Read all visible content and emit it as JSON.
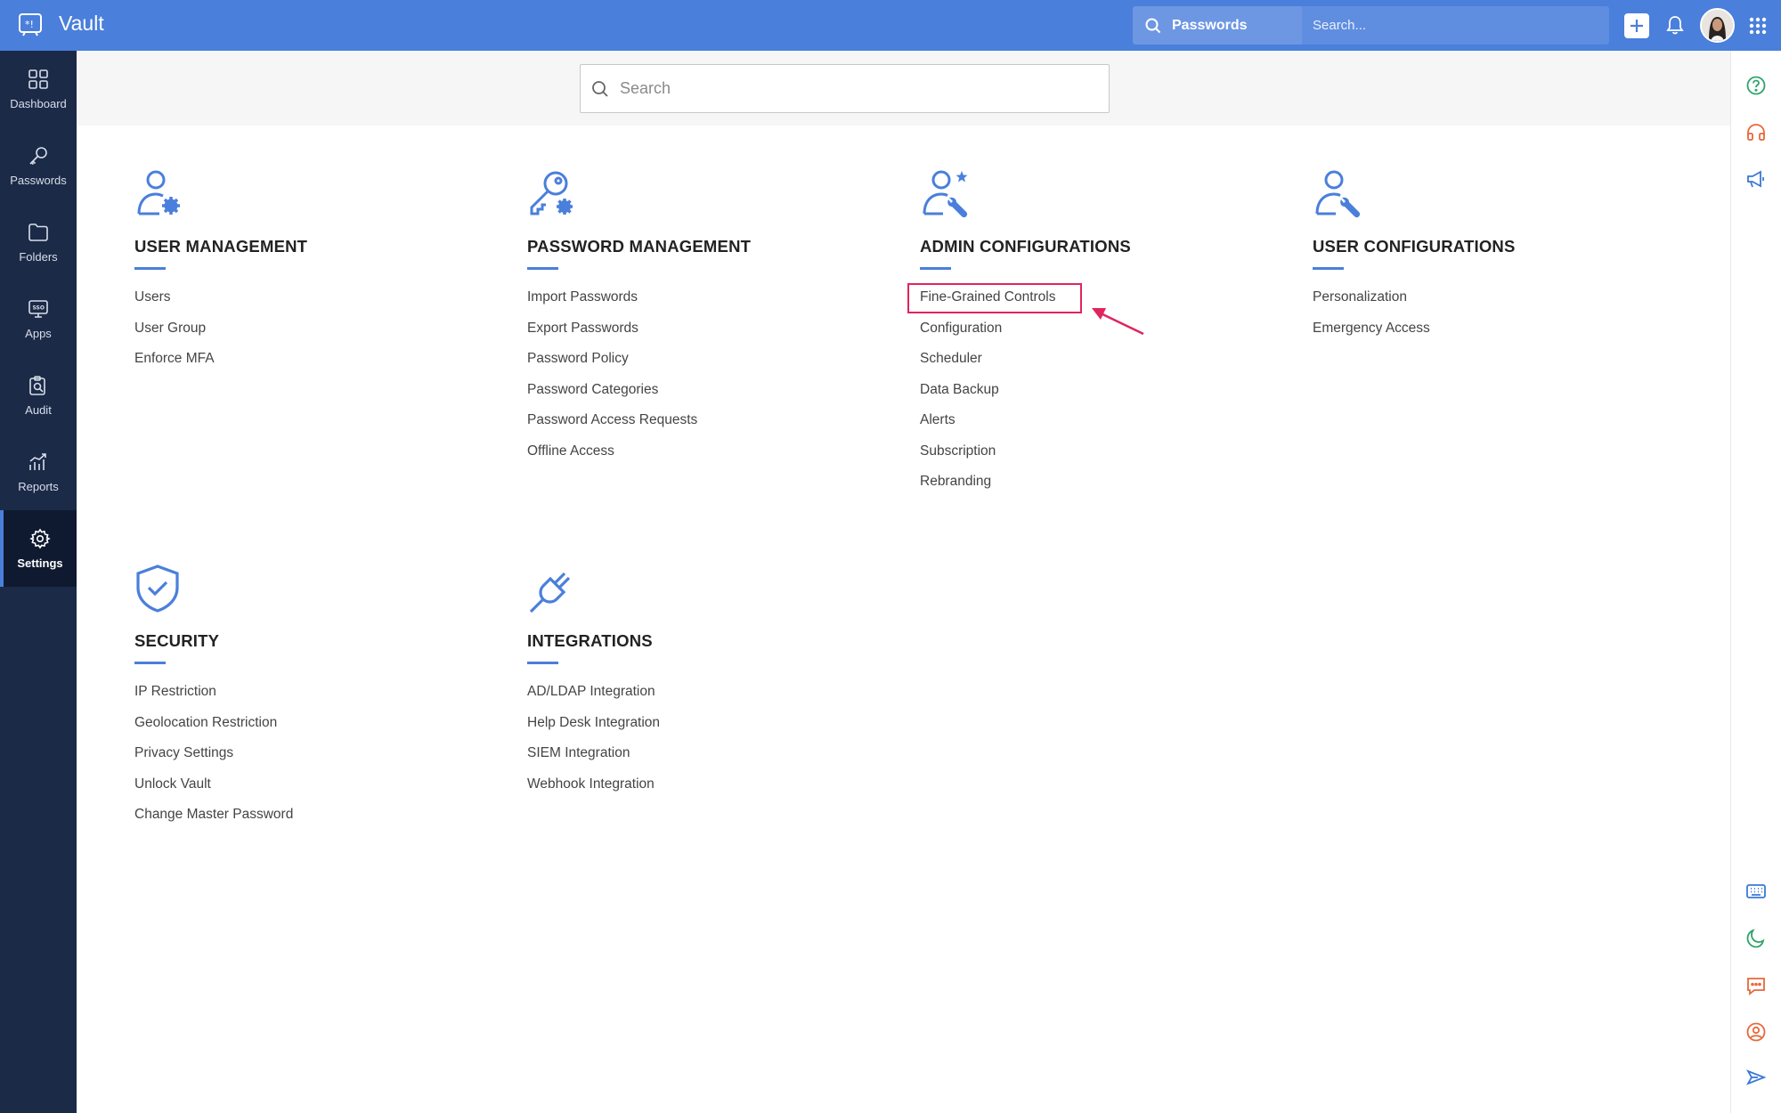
{
  "app": {
    "title": "Vault"
  },
  "topbar": {
    "search_scope": "Passwords",
    "search_placeholder": "Search...",
    "icons": [
      "vault-logo-icon",
      "search-icon",
      "plus-icon",
      "bell-icon",
      "avatar",
      "app-grid-icon"
    ]
  },
  "sidebar": {
    "items": [
      {
        "label": "Dashboard",
        "icon": "dashboard-icon"
      },
      {
        "label": "Passwords",
        "icon": "key-icon"
      },
      {
        "label": "Folders",
        "icon": "folder-icon"
      },
      {
        "label": "Apps",
        "icon": "sso-icon"
      },
      {
        "label": "Audit",
        "icon": "audit-icon"
      },
      {
        "label": "Reports",
        "icon": "reports-icon"
      },
      {
        "label": "Settings",
        "icon": "gear-icon",
        "active": true
      }
    ]
  },
  "main_search": {
    "placeholder": "Search"
  },
  "sections": {
    "user_management": {
      "title": "USER MANAGEMENT",
      "items": [
        "Users",
        "User Group",
        "Enforce MFA"
      ]
    },
    "password_management": {
      "title": "PASSWORD MANAGEMENT",
      "items": [
        "Import Passwords",
        "Export Passwords",
        "Password Policy",
        "Password Categories",
        "Password Access Requests",
        "Offline Access"
      ]
    },
    "admin_configurations": {
      "title": "ADMIN CONFIGURATIONS",
      "items": [
        "Fine-Grained Controls",
        "Configuration",
        "Scheduler",
        "Data Backup",
        "Alerts",
        "Subscription",
        "Rebranding"
      ]
    },
    "user_configurations": {
      "title": "USER CONFIGURATIONS",
      "items": [
        "Personalization",
        "Emergency Access"
      ]
    },
    "security": {
      "title": "SECURITY",
      "items": [
        "IP Restriction",
        "Geolocation Restriction",
        "Privacy Settings",
        "Unlock Vault",
        "Change Master Password"
      ]
    },
    "integrations": {
      "title": "INTEGRATIONS",
      "items": [
        "AD/LDAP Integration",
        "Help Desk Integration",
        "SIEM Integration",
        "Webhook Integration"
      ]
    }
  },
  "right_rail": {
    "icons": [
      "help-icon",
      "headset-icon",
      "megaphone-icon",
      "keyboard-icon",
      "moon-icon",
      "chat-icon",
      "contact-icon",
      "send-icon"
    ]
  },
  "colors": {
    "topbar": "#4a7fdb",
    "sidebar": "#1b2a47",
    "accent": "#4a7fdb",
    "highlight": "#e0245e"
  }
}
